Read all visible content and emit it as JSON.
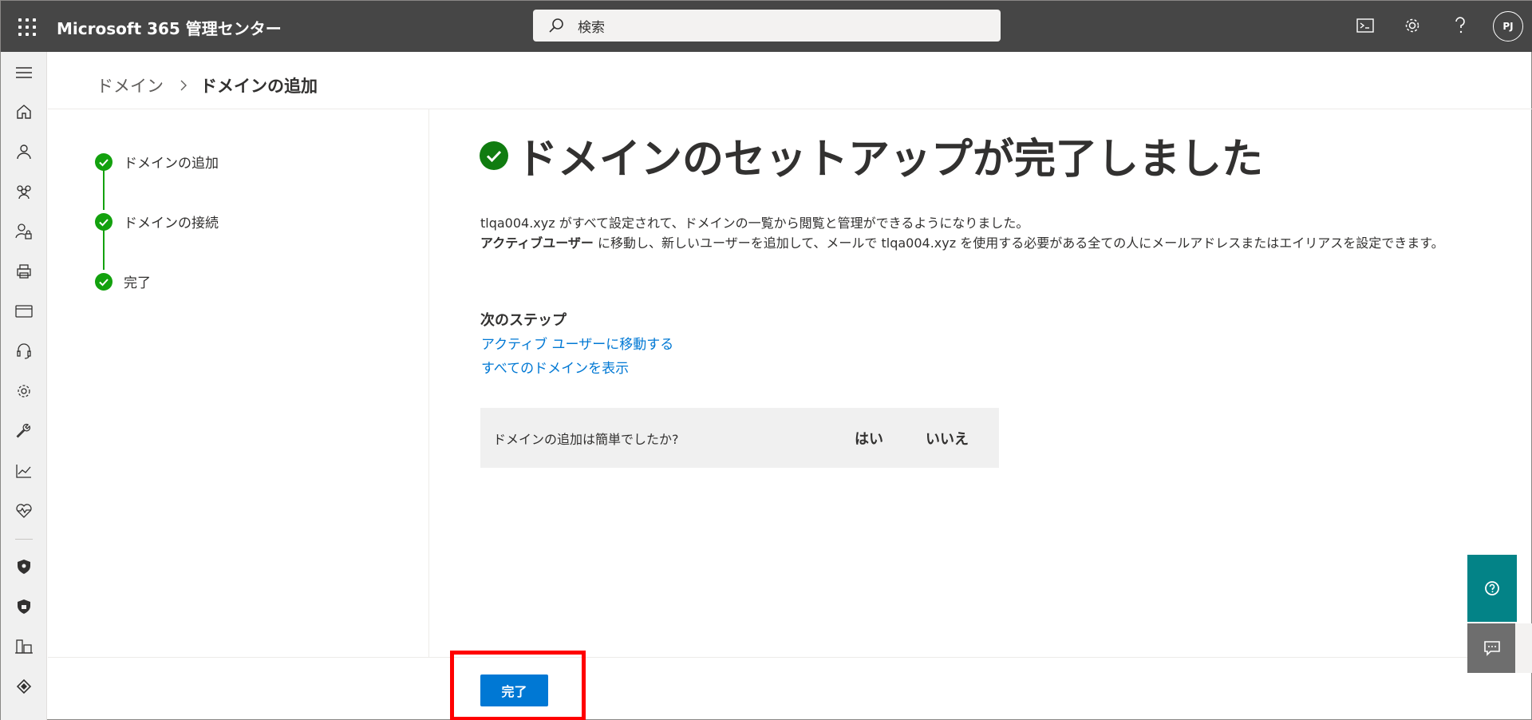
{
  "app": {
    "title": "Microsoft 365 管理センター"
  },
  "search": {
    "placeholder": "検索"
  },
  "user": {
    "initials": "PJ"
  },
  "topbar_icons": [
    "waffle-icon",
    "terminal-icon",
    "gear-icon",
    "help-icon"
  ],
  "nav_icons": [
    "menu-icon",
    "home-icon",
    "user-icon",
    "group-icon",
    "user-lock-icon",
    "printer-icon",
    "billing-card-icon",
    "headset-icon",
    "gear-icon",
    "wrench-icon",
    "chart-icon",
    "health-heart-icon",
    "shield-icon",
    "shield-icon",
    "admin-centers-icon",
    "azure-icon"
  ],
  "breadcrumb": {
    "parent": "ドメイン",
    "current": "ドメインの追加"
  },
  "steps": [
    {
      "label": "ドメインの追加",
      "status": "complete"
    },
    {
      "label": "ドメインの接続",
      "status": "complete"
    },
    {
      "label": "完了",
      "status": "complete"
    }
  ],
  "main": {
    "title": "ドメインのセットアップが完了しました",
    "line1": "tlqa004.xyz がすべて設定されて、ドメインの一覧から閲覧と管理ができるようになりました。",
    "line2_bold": "アクティブユーザー",
    "line2_rest": " に移動し、新しいユーザーを追加して、メールで tlqa004.xyz を使用する必要がある全ての人にメールアドレスまたはエイリアスを設定できます。",
    "next_steps_heading": "次のステップ",
    "links": [
      "アクティブ ユーザーに移動する",
      "すべてのドメインを表示"
    ]
  },
  "feedback": {
    "question": "ドメインの追加は簡単でしたか?",
    "yes": "はい",
    "no": "いいえ"
  },
  "footer": {
    "done_label": "完了"
  },
  "colors": {
    "topbar": "#464646",
    "accent": "#0078d4",
    "success": "#13a10e",
    "help": "#038387",
    "highlight": "#ff0000"
  }
}
